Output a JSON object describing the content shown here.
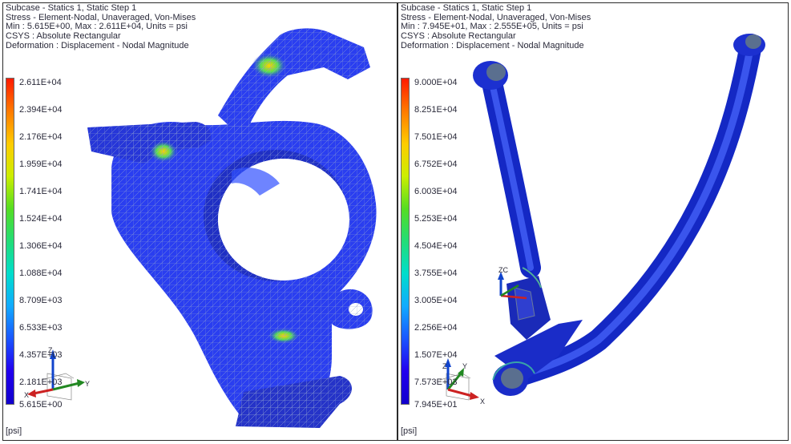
{
  "left_view": {
    "header_lines": [
      "Subcase - Statics 1, Static Step 1",
      "Stress - Element-Nodal, Unaveraged, Von-Mises",
      "Min : 5.615E+00, Max : 2.611E+04, Units = psi",
      "CSYS : Absolute Rectangular",
      "Deformation : Displacement - Nodal Magnitude"
    ],
    "legend_ticks": [
      "2.611E+04",
      "2.394E+04",
      "2.176E+04",
      "1.959E+04",
      "1.741E+04",
      "1.524E+04",
      "1.306E+04",
      "1.088E+04",
      "8.709E+03",
      "6.533E+03",
      "4.357E+03",
      "2.181E+03",
      "5.615E+00"
    ],
    "unit_label": "[psi]",
    "triad": {
      "z": "Z",
      "y": "Y",
      "x": "X"
    }
  },
  "right_view": {
    "header_lines": [
      "Subcase - Statics 1, Static Step 1",
      "Stress - Element-Nodal, Unaveraged, Von-Mises",
      "Min : 7.945E+01, Max : 2.555E+05, Units = psi",
      "CSYS : Absolute Rectangular",
      "Deformation : Displacement - Nodal Magnitude"
    ],
    "legend_ticks": [
      "9.000E+04",
      "8.251E+04",
      "7.501E+04",
      "6.752E+04",
      "6.003E+04",
      "5.253E+04",
      "4.504E+04",
      "3.755E+04",
      "3.005E+04",
      "2.256E+04",
      "1.507E+04",
      "7.573E+03",
      "7.945E+01"
    ],
    "unit_label": "[psi]",
    "triad": {
      "z": "Z",
      "y": "Y",
      "x": "X"
    },
    "wcs_label": "ZC"
  },
  "colors": {
    "legend_gradient": [
      "#ff1a00",
      "#ff7a00",
      "#ffcc00",
      "#ccee00",
      "#55dd22",
      "#22dd77",
      "#00ddcc",
      "#11aaff",
      "#1a55ff",
      "#2200ee",
      "#1100cc"
    ],
    "mesh_blue": "#2a3ef0",
    "hot": "#ff9a00"
  }
}
